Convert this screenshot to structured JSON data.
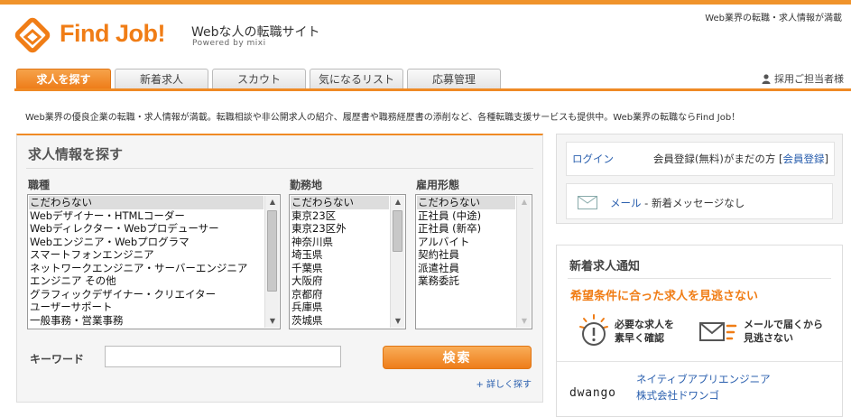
{
  "header": {
    "tagline_right": "Web業界の転職・求人情報が満載",
    "brand": "Find Job!",
    "brand_sub": "Webな人の転職サイト",
    "brand_powered": "Powered by mixi",
    "recruiter_link": "採用ご担当者様",
    "accent_color": "#f07d16"
  },
  "nav": {
    "tabs": [
      {
        "label": "求人を探す",
        "active": true
      },
      {
        "label": "新着求人",
        "active": false
      },
      {
        "label": "スカウト",
        "active": false
      },
      {
        "label": "気になるリスト",
        "active": false
      },
      {
        "label": "応募管理",
        "active": false
      }
    ]
  },
  "intro": "Web業界の優良企業の転職・求人情報が満載。転職相談や非公開求人の紹介、履歴書や職務経歴書の添削など、各種転職支援サービスも提供中。Web業界の転職ならFind Job！",
  "search": {
    "title": "求人情報を探す",
    "job_type": {
      "label": "職種",
      "options": [
        "こだわらない",
        "Webデザイナー・HTMLコーダー",
        "Webディレクター・Webプロデューサー",
        "Webエンジニア・Webプログラマ",
        "スマートフォンエンジニア",
        "ネットワークエンジニア・サーバーエンジニア",
        "エンジニア その他",
        "グラフィックデザイナー・クリエイター",
        "ユーザーサポート",
        "一般事務・営業事務"
      ],
      "selected": "こだわらない"
    },
    "location": {
      "label": "勤務地",
      "options": [
        "こだわらない",
        "東京23区",
        "東京23区外",
        "神奈川県",
        "埼玉県",
        "千葉県",
        "大阪府",
        "京都府",
        "兵庫県",
        "茨城県"
      ],
      "selected": "こだわらない"
    },
    "employment": {
      "label": "雇用形態",
      "options": [
        "こだわらない",
        "正社員 (中途)",
        "正社員 (新卒)",
        "アルバイト",
        "契約社員",
        "派遣社員",
        "業務委託"
      ],
      "selected": "こだわらない"
    },
    "keyword_label": "キーワード",
    "keyword_value": "",
    "button_label": "検索",
    "detail_link": "+ 詳しく探す"
  },
  "account": {
    "login_label": "ログイン",
    "register_prefix": "会員登録(無料)がまだの方 [",
    "register_link": "会員登録",
    "register_suffix": "]",
    "mail_link": "メール",
    "mail_status": " - 新着メッセージなし"
  },
  "notice": {
    "title": "新着求人通知",
    "headline": "希望条件に合った求人を見逃さない",
    "feature1_line1": "必要な求人を",
    "feature1_line2": "素早く確認",
    "feature2_line1": "メールで届くから",
    "feature2_line2": "見逃さない",
    "job": {
      "company_logo_text": "dwango",
      "title": "ネイティブアプリエンジニア",
      "company": "株式会社ドワンゴ"
    }
  }
}
